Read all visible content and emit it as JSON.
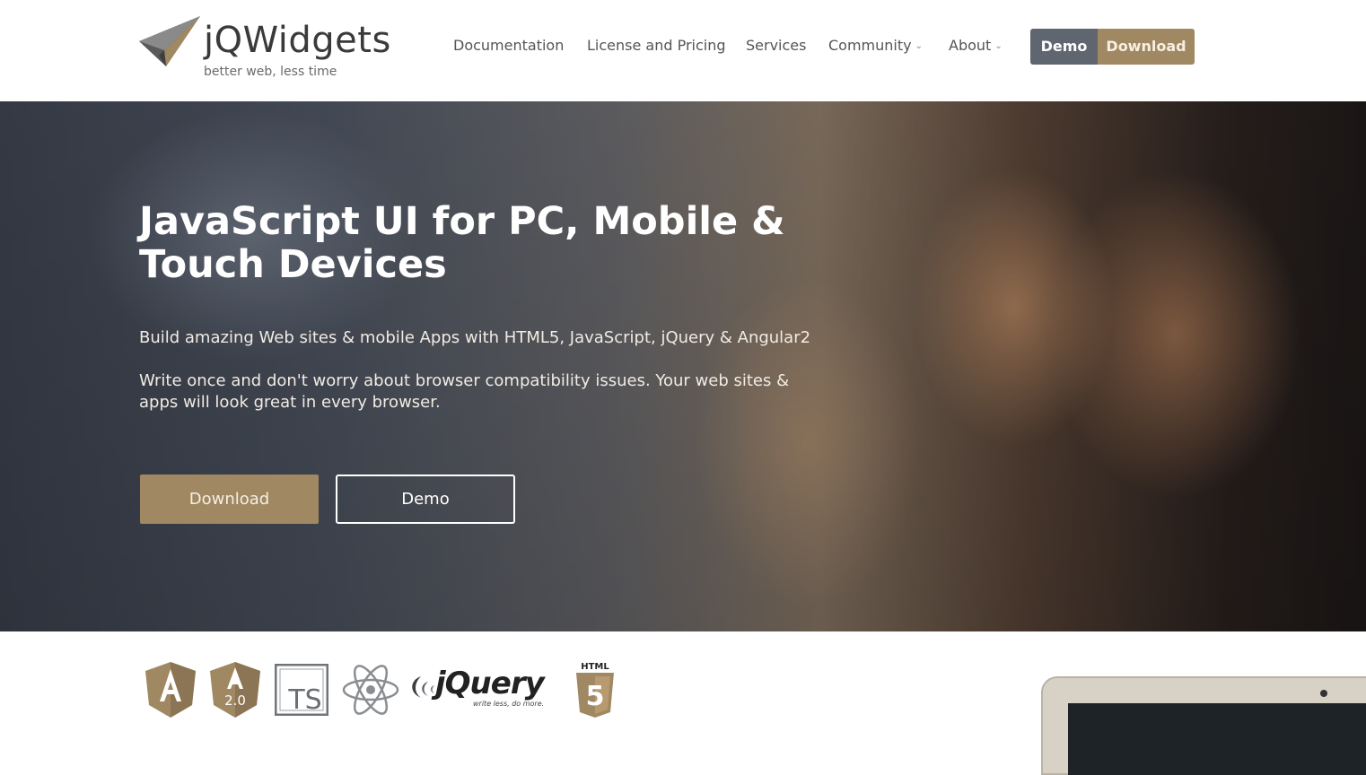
{
  "brand": {
    "name": "jQWidgets",
    "tagline": "better web, less time",
    "accent_color": "#a08862",
    "dark_button_color": "#5f6670"
  },
  "nav": {
    "items": [
      {
        "label": "Documentation",
        "has_dropdown": false
      },
      {
        "label": "License and Pricing",
        "has_dropdown": false
      },
      {
        "label": "Services",
        "has_dropdown": false
      },
      {
        "label": "Community",
        "has_dropdown": true
      },
      {
        "label": "About",
        "has_dropdown": true
      }
    ],
    "demo_button": "Demo",
    "download_button": "Download"
  },
  "hero": {
    "title": "JavaScript UI for PC, Mobile & Touch Devices",
    "paragraph1": "Build amazing Web sites & mobile Apps with HTML5, JavaScript, jQuery & Angular2",
    "paragraph2": "Write once and don't worry about browser compatibility issues. Your web sites & apps will look great in every browser.",
    "download_button": "Download",
    "demo_button": "Demo"
  },
  "technologies": {
    "items": [
      "angular-icon",
      "angular2-icon",
      "typescript-icon",
      "react-icon",
      "jquery-logo",
      "html5-icon"
    ],
    "angular2_version": "2.0",
    "typescript_label": "TS",
    "html5_label": "HTML",
    "html5_number": "5",
    "jquery_name": "jQuery",
    "jquery_tagline": "write less, do more."
  }
}
